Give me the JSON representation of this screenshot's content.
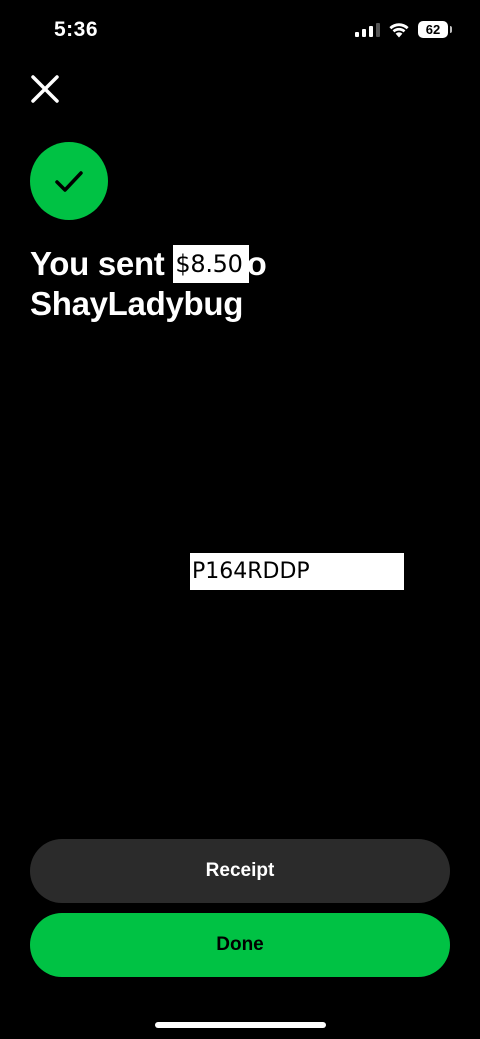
{
  "status_bar": {
    "time": "5:36",
    "battery": "62",
    "icons": [
      "cellular-signal-icon",
      "wifi-icon",
      "battery-icon"
    ]
  },
  "close": {
    "icon": "close-icon"
  },
  "success": {
    "icon": "checkmark-icon",
    "color": "#00c244"
  },
  "headline": {
    "prefix": "You sent ",
    "amount": "$8.50",
    "suffix": "o",
    "recipient": "ShayLadybug"
  },
  "code": "P164RDDP",
  "buttons": {
    "receipt_label": "Receipt",
    "done_label": "Done"
  },
  "colors": {
    "background": "#000000",
    "accent": "#00c244",
    "secondary_button": "#2b2b2b"
  }
}
